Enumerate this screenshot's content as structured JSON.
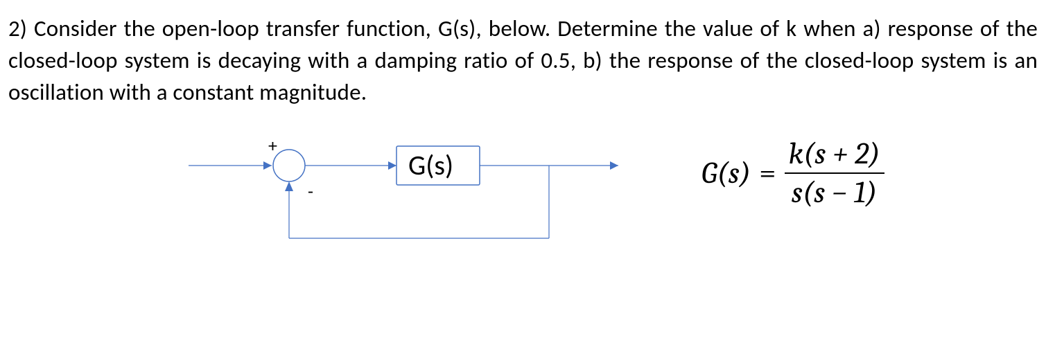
{
  "problem": {
    "number": "2)",
    "text": "Consider the open-loop transfer function, G(s), below. Determine the value of k when a) response of the closed-loop system is decaying with a damping ratio of 0.5, b) the response of the closed-loop system is an oscillation with a constant magnitude."
  },
  "diagram": {
    "type": "block-diagram",
    "summing_signs": {
      "plus": "+",
      "minus": "-"
    },
    "block_label": "G(s)",
    "feedback": "unity-negative"
  },
  "equation": {
    "lhs": "G(s)",
    "eq": "=",
    "numerator": "k(s + 2)",
    "denominator": "s(s − 1)"
  },
  "chart_data": {
    "type": "block-diagram",
    "nodes": [
      {
        "id": "sum",
        "kind": "summing-junction",
        "signs": [
          "+",
          "-"
        ]
      },
      {
        "id": "G",
        "kind": "transfer-function",
        "label": "G(s)",
        "expr": "k(s+2)/(s(s-1))"
      }
    ],
    "edges": [
      {
        "from": "input",
        "to": "sum"
      },
      {
        "from": "sum",
        "to": "G"
      },
      {
        "from": "G",
        "to": "output"
      },
      {
        "from": "output",
        "to": "sum",
        "feedback": true,
        "sign": "-"
      }
    ],
    "tasks": [
      {
        "part": "a",
        "condition": "closed-loop damping ratio = 0.5",
        "find": "k"
      },
      {
        "part": "b",
        "condition": "closed-loop response is constant-magnitude oscillation (damping ratio = 0)",
        "find": "k"
      }
    ]
  }
}
